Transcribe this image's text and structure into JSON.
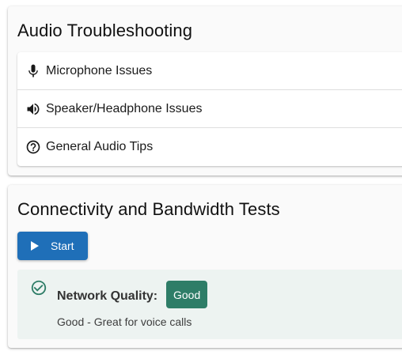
{
  "audio": {
    "title": "Audio Troubleshooting",
    "items": [
      {
        "label": "Microphone Issues",
        "icon": "microphone-icon"
      },
      {
        "label": "Speaker/Headphone Issues",
        "icon": "speaker-icon"
      },
      {
        "label": "General Audio Tips",
        "icon": "help-circle-icon"
      }
    ]
  },
  "network": {
    "title": "Connectivity and Bandwidth Tests",
    "start_label": "Start",
    "quality_label": "Network Quality:",
    "quality_value": "Good",
    "quality_description": "Good - Great for voice calls"
  },
  "colors": {
    "primary": "#1f6fb8",
    "success": "#2e7d67",
    "result_bg": "#edf3f1"
  }
}
